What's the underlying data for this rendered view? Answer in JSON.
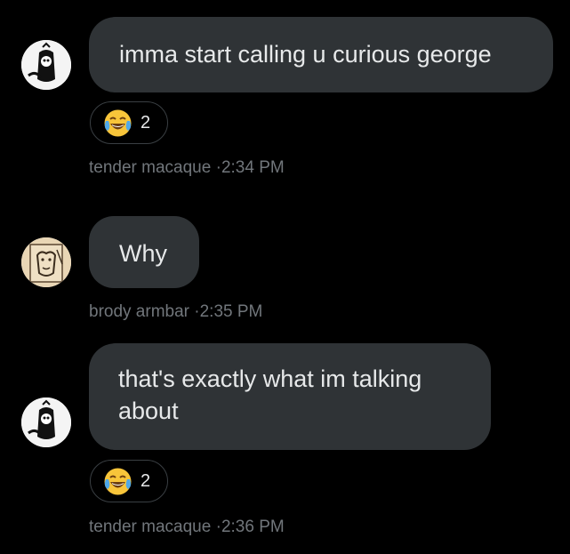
{
  "messages": [
    {
      "text": "imma start calling u curious george",
      "reaction": {
        "emoji": "crying-laughing-emoji",
        "count": "2"
      },
      "sender": "tender macaque",
      "separator": "·",
      "time": "2:34 PM"
    },
    {
      "text": "Why",
      "sender": "brody armbar",
      "separator": "·",
      "time": "2:35 PM"
    },
    {
      "text_line1": "that's exactly what im talking",
      "text_line2": "about",
      "reaction": {
        "emoji": "crying-laughing-emoji",
        "count": "2"
      },
      "sender": "tender macaque",
      "separator": "·",
      "time": "2:36 PM"
    }
  ],
  "colors": {
    "background": "#000000",
    "bubble": "#2f3336",
    "meta": "#71767b",
    "text": "#e7e9ea"
  }
}
